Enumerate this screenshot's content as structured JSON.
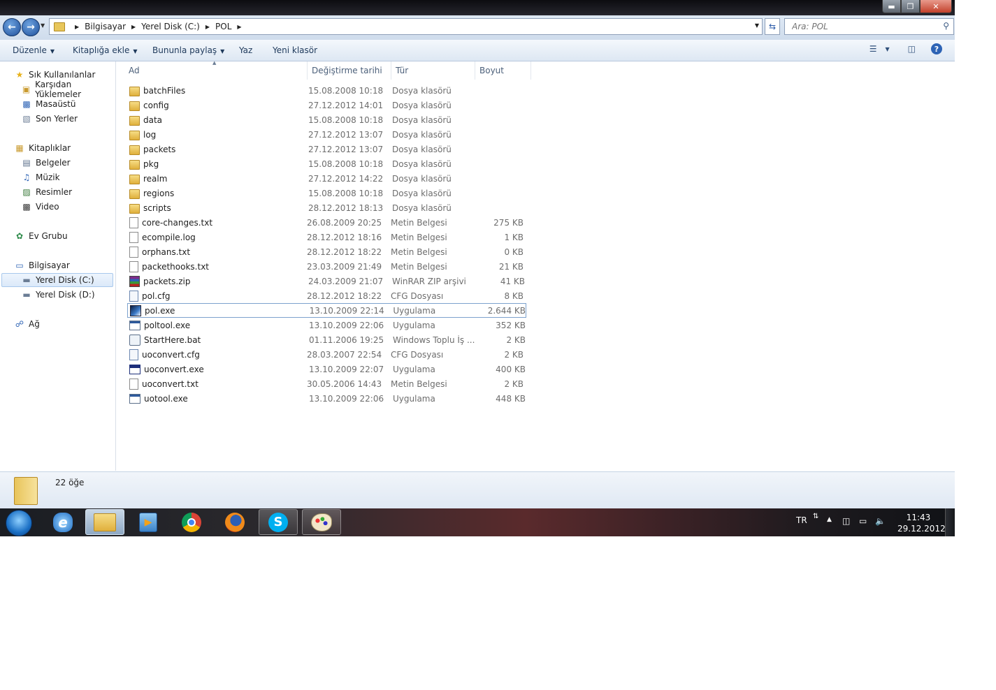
{
  "address": {
    "crumbs": [
      "Bilgisayar",
      "Yerel Disk (C:)",
      "POL"
    ]
  },
  "search": {
    "placeholder": "Ara: POL"
  },
  "toolbar": {
    "organize": "Düzenle",
    "add_to_library": "Kitaplığa ekle",
    "share_with": "Bununla paylaş",
    "burn": "Yaz",
    "new_folder": "Yeni klasör"
  },
  "nav": {
    "favorites": "Sık Kullanılanlar",
    "downloads": "Karşıdan Yüklemeler",
    "desktop": "Masaüstü",
    "recent": "Son Yerler",
    "libraries": "Kitaplıklar",
    "documents": "Belgeler",
    "music": "Müzik",
    "pictures": "Resimler",
    "videos": "Video",
    "homegroup": "Ev Grubu",
    "computer": "Bilgisayar",
    "disk_c": "Yerel Disk (C:)",
    "disk_d": "Yerel Disk (D:)",
    "network": "Ağ"
  },
  "columns": {
    "name": "Ad",
    "date": "Değiştirme tarihi",
    "type": "Tür",
    "size": "Boyut"
  },
  "files": [
    {
      "name": "batchFiles",
      "date": "15.08.2008 10:18",
      "type": "Dosya klasörü",
      "size": "",
      "icon": "folder-icon"
    },
    {
      "name": "config",
      "date": "27.12.2012 14:01",
      "type": "Dosya klasörü",
      "size": "",
      "icon": "folder-icon"
    },
    {
      "name": "data",
      "date": "15.08.2008 10:18",
      "type": "Dosya klasörü",
      "size": "",
      "icon": "folder-icon"
    },
    {
      "name": "log",
      "date": "27.12.2012 13:07",
      "type": "Dosya klasörü",
      "size": "",
      "icon": "folder-icon"
    },
    {
      "name": "packets",
      "date": "27.12.2012 13:07",
      "type": "Dosya klasörü",
      "size": "",
      "icon": "folder-icon"
    },
    {
      "name": "pkg",
      "date": "15.08.2008 10:18",
      "type": "Dosya klasörü",
      "size": "",
      "icon": "folder-icon"
    },
    {
      "name": "realm",
      "date": "27.12.2012 14:22",
      "type": "Dosya klasörü",
      "size": "",
      "icon": "folder-icon"
    },
    {
      "name": "regions",
      "date": "15.08.2008 10:18",
      "type": "Dosya klasörü",
      "size": "",
      "icon": "folder-icon"
    },
    {
      "name": "scripts",
      "date": "28.12.2012 18:13",
      "type": "Dosya klasörü",
      "size": "",
      "icon": "folder-icon"
    },
    {
      "name": "core-changes.txt",
      "date": "26.08.2009 20:25",
      "type": "Metin Belgesi",
      "size": "275 KB",
      "icon": "text-file-icon"
    },
    {
      "name": "ecompile.log",
      "date": "28.12.2012 18:16",
      "type": "Metin Belgesi",
      "size": "1 KB",
      "icon": "text-file-icon"
    },
    {
      "name": "orphans.txt",
      "date": "28.12.2012 18:22",
      "type": "Metin Belgesi",
      "size": "0 KB",
      "icon": "text-file-icon"
    },
    {
      "name": "packethooks.txt",
      "date": "23.03.2009 21:49",
      "type": "Metin Belgesi",
      "size": "21 KB",
      "icon": "text-file-icon"
    },
    {
      "name": "packets.zip",
      "date": "24.03.2009 21:07",
      "type": "WinRAR ZIP arşivi",
      "size": "41 KB",
      "icon": "winrar-archive-icon"
    },
    {
      "name": "pol.cfg",
      "date": "28.12.2012 18:22",
      "type": "CFG Dosyası",
      "size": "8 KB",
      "icon": "config-file-icon"
    },
    {
      "name": "pol.exe",
      "date": "13.10.2009 22:14",
      "type": "Uygulama",
      "size": "2.644 KB",
      "icon": "pol-application-icon"
    },
    {
      "name": "poltool.exe",
      "date": "13.10.2009 22:06",
      "type": "Uygulama",
      "size": "352 KB",
      "icon": "application-icon"
    },
    {
      "name": "StartHere.bat",
      "date": "01.11.2006 19:25",
      "type": "Windows Toplu İş ...",
      "size": "2 KB",
      "icon": "batch-file-icon"
    },
    {
      "name": "uoconvert.cfg",
      "date": "28.03.2007 22:54",
      "type": "CFG Dosyası",
      "size": "2 KB",
      "icon": "config-file-icon"
    },
    {
      "name": "uoconvert.exe",
      "date": "13.10.2009 22:07",
      "type": "Uygulama",
      "size": "400 KB",
      "icon": "uoconvert-application-icon"
    },
    {
      "name": "uoconvert.txt",
      "date": "30.05.2006 14:43",
      "type": "Metin Belgesi",
      "size": "2 KB",
      "icon": "text-file-icon"
    },
    {
      "name": "uotool.exe",
      "date": "13.10.2009 22:06",
      "type": "Uygulama",
      "size": "448 KB",
      "icon": "application-icon"
    }
  ],
  "status": {
    "item_count": "22 öğe"
  },
  "taskbar": {
    "apps": [
      "start-orb-icon",
      "internet-explorer-icon",
      "windows-explorer-icon",
      "media-player-icon",
      "chrome-icon",
      "firefox-icon",
      "skype-icon",
      "paint-icon"
    ],
    "language": "TR",
    "time": "11:43",
    "date": "29.12.2012"
  },
  "colors": {
    "accent": "#1f4f9a",
    "selection_border": "#7da2ce"
  }
}
